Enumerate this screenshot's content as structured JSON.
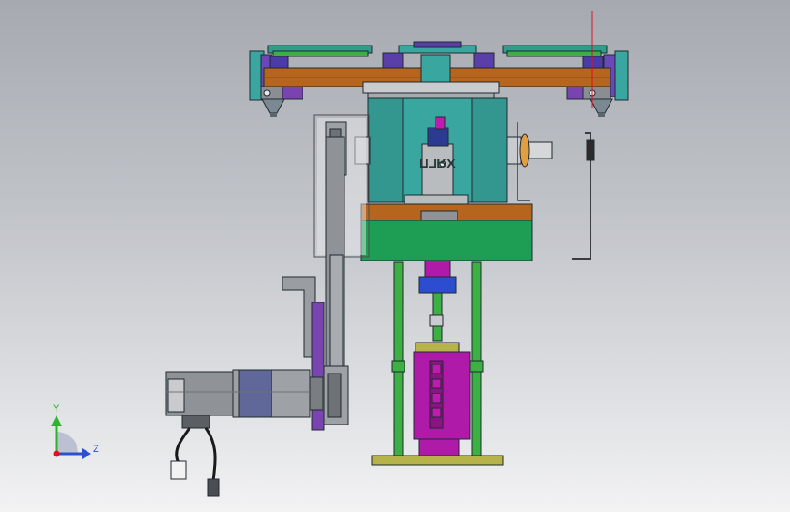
{
  "view": {
    "background_top": "#a6aab0",
    "background_bottom": "#f2f2f3"
  },
  "colors": {
    "brown_plate": "#b5651d",
    "teal_housing": "#3aa6a0",
    "green_base": "#1e9e55",
    "green_column": "#3cb043",
    "magenta_cylinder": "#b01aa8",
    "purple_bracket": "#7a44b0",
    "blue_nut": "#2c4dd0",
    "grey_motor": "#8f9296",
    "olive_base": "#b5b34a",
    "guide_red": "#e0101e",
    "dark_green_rail": "#1e6b3a"
  },
  "engraving": {
    "text": "XЯГП"
  },
  "triad": {
    "y_label": "Y",
    "z_label": "Z",
    "y_color": "#2ab52a",
    "z_color": "#2a52d0",
    "x_color": "#e0101e"
  }
}
